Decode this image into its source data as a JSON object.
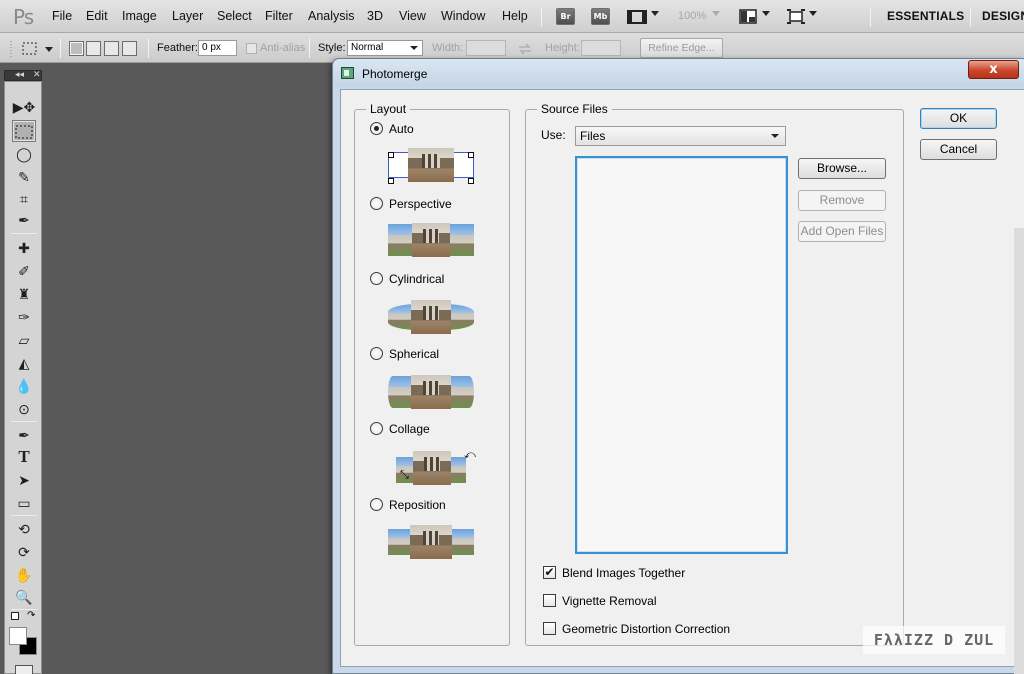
{
  "app": {
    "logo": "Ps"
  },
  "menubar": {
    "items": [
      "File",
      "Edit",
      "Image",
      "Layer",
      "Select",
      "Filter",
      "Analysis",
      "3D",
      "View",
      "Window",
      "Help"
    ],
    "bridge_label": "Br",
    "minibridge_label": "Mb",
    "zoom": "100%",
    "workspaces": [
      "ESSENTIALS",
      "DESIGN"
    ]
  },
  "options": {
    "feather_label": "Feather:",
    "feather_value": "0 px",
    "antialias_label": "Anti-alias",
    "style_label": "Style:",
    "style_value": "Normal",
    "width_label": "Width:",
    "height_label": "Height:",
    "refine_label": "Refine Edge..."
  },
  "tools": {
    "collapse": "◂◂",
    "close": "✕",
    "items": [
      "move-tool",
      "marquee-tool",
      "lasso-tool",
      "quick-select-tool",
      "crop-tool",
      "eyedropper-tool",
      "healing-brush-tool",
      "brush-tool",
      "clone-stamp-tool",
      "history-brush-tool",
      "eraser-tool",
      "paint-bucket-tool",
      "blur-tool",
      "dodge-tool",
      "pen-tool",
      "type-tool",
      "path-select-tool",
      "rectangle-tool",
      "3d-rotate-tool",
      "3d-orbit-tool",
      "hand-tool",
      "zoom-tool"
    ]
  },
  "dialog": {
    "title": "Photomerge",
    "close_glyph": "x",
    "layout": {
      "legend": "Layout",
      "options": [
        {
          "label": "Auto",
          "checked": true
        },
        {
          "label": "Perspective",
          "checked": false
        },
        {
          "label": "Cylindrical",
          "checked": false
        },
        {
          "label": "Spherical",
          "checked": false
        },
        {
          "label": "Collage",
          "checked": false
        },
        {
          "label": "Reposition",
          "checked": false
        }
      ]
    },
    "source": {
      "legend": "Source Files",
      "use_label": "Use:",
      "use_value": "Files",
      "files": [],
      "browse": "Browse...",
      "remove": "Remove",
      "add_open": "Add Open Files"
    },
    "options": [
      {
        "label": "Blend Images Together",
        "checked": true
      },
      {
        "label": "Vignette Removal",
        "checked": false
      },
      {
        "label": "Geometric Distortion Correction",
        "checked": false
      }
    ],
    "ok": "OK",
    "cancel": "Cancel"
  },
  "watermark": "FλλIZZ D ZUL",
  "colors": {
    "accent": "#3a8fcf",
    "close_red": "#c8462b",
    "dialog_frame": "#c9d9ea"
  }
}
